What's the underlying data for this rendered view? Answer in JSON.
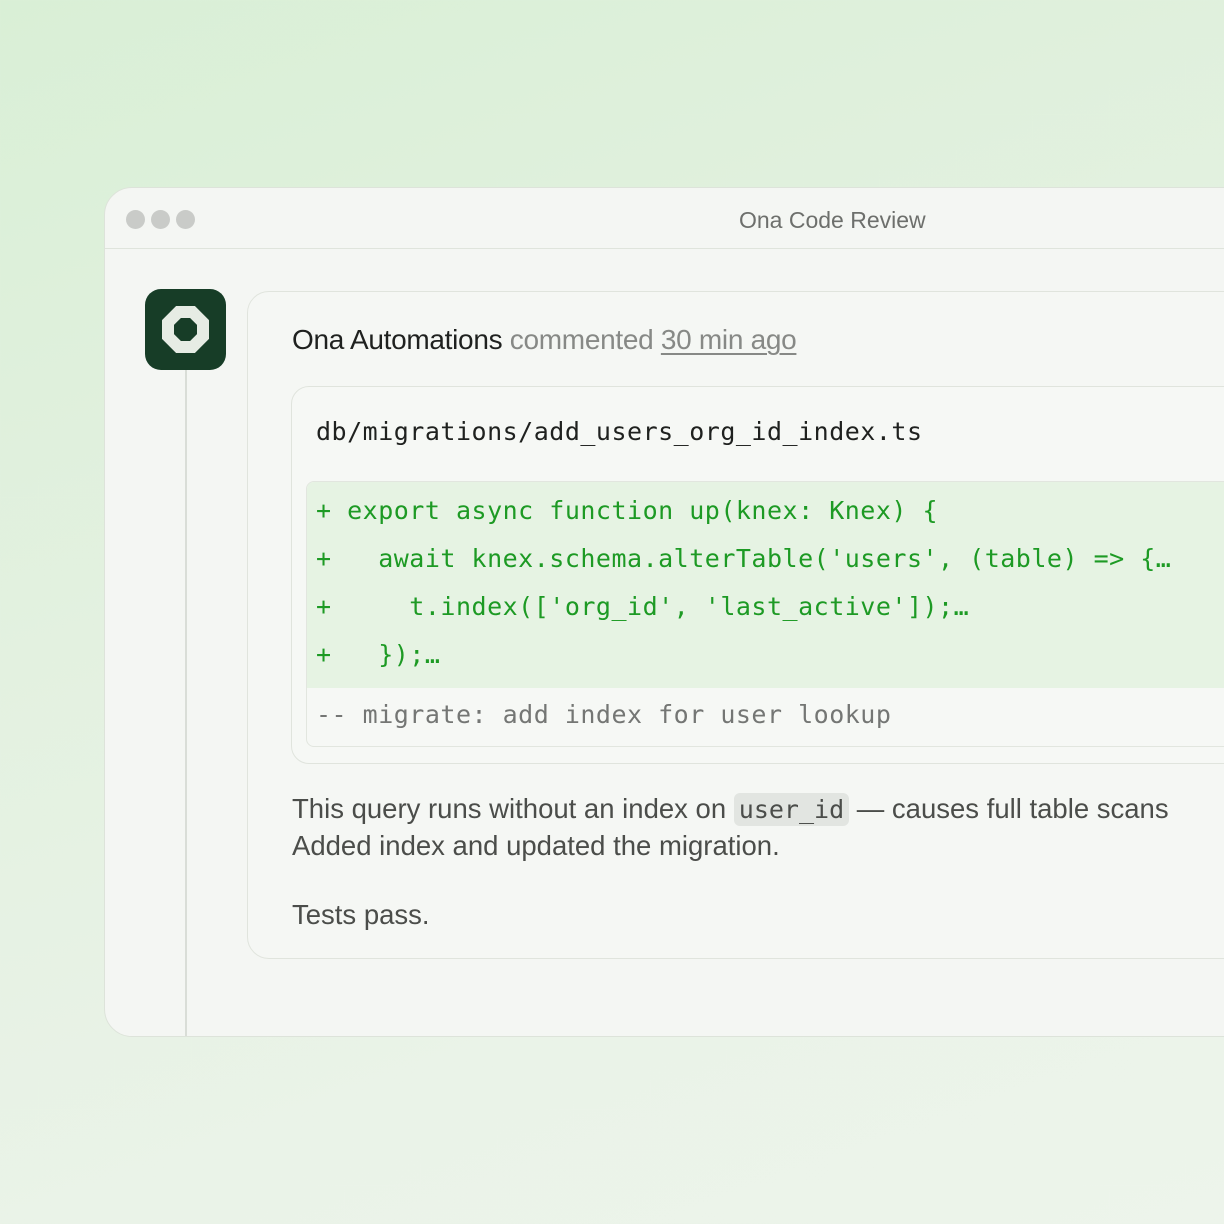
{
  "window": {
    "title": "Ona Code Review"
  },
  "comment": {
    "author": "Ona Automations",
    "verb": "commented",
    "timestamp": "30 min ago",
    "file": {
      "path": "db/migrations/add_users_org_id_index.ts",
      "added_lines": [
        "+ export async function up(knex: Knex) {",
        "+   await knex.schema.alterTable('users', (table) => {…",
        "+     t.index(['org_id', 'last_active']);…",
        "+   });…"
      ],
      "context_line": "-- migrate: add index for user lookup"
    },
    "body": {
      "line1_before": "This query runs without an index on ",
      "line1_code": "user_id",
      "line1_after": " — causes full table scans",
      "line2": "Added index and updated the migration.",
      "line3": "Tests pass."
    }
  },
  "colors": {
    "avatar_bg": "#173d27",
    "added_code": "#1d9a24",
    "added_bg": "#e6f3e3"
  },
  "icons": {
    "avatar": "ona-octagon-logo-icon",
    "window_controls": "traffic-light-dots"
  }
}
